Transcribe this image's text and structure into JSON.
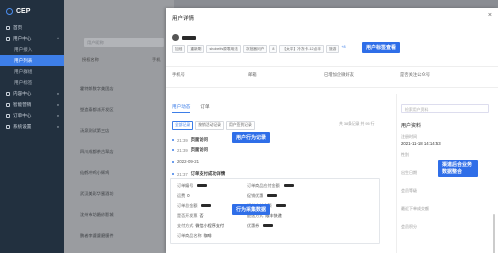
{
  "sidebar": {
    "logo": "CEP",
    "items": [
      {
        "label": "首页",
        "sub": false,
        "active": false
      },
      {
        "label": "用户中心",
        "sub": false,
        "active": false,
        "caret": "^"
      },
      {
        "label": "用户接入",
        "sub": true,
        "active": false
      },
      {
        "label": "用户列表",
        "sub": true,
        "active": true
      },
      {
        "label": "用户群组",
        "sub": true,
        "active": false
      },
      {
        "label": "用户标签",
        "sub": true,
        "active": false
      },
      {
        "label": "内容中心",
        "sub": false,
        "active": false,
        "caret": "v"
      },
      {
        "label": "智能营销",
        "sub": false,
        "active": false,
        "caret": "v"
      },
      {
        "label": "订单中心",
        "sub": false,
        "active": false,
        "caret": "v"
      },
      {
        "label": "系统设置",
        "sub": false,
        "active": false,
        "caret": "v"
      }
    ]
  },
  "main": {
    "search_placeholder": "用户昵称",
    "col_name": "授权名称",
    "col_phone": "手机",
    "rows": [
      "霍特郎数字美团店",
      "塑造泰都派开发区",
      "汤泉测试第三店",
      "四川成都茶古翠店",
      "仙鹤冲鸡小辉鸡",
      "武汉美彩华蜜酒坊",
      "沈州市坊婚纱影城",
      "鹏者李婆婆磨膜件"
    ]
  },
  "panel": {
    "title": "用户详情",
    "close": "×",
    "tags": [
      "加冠",
      "重新刷",
      "shobelfs原零用法",
      "次批器问户",
      "8",
      "【太平】冷冻卡-12点半",
      "旅游"
    ],
    "tags_more": "+8",
    "callout_tags": "用户标签查看",
    "callout_behavior": "用户行为记录",
    "callout_collect": "行为采集数据",
    "callout_merge": "渠道后合业务数据整合",
    "info_labels": [
      "手机号",
      "邮箱",
      "已增加企微好友",
      "是否关注公众号"
    ],
    "tabs": [
      "用户动态",
      "订单"
    ],
    "filters": [
      "全部记录",
      "按销活动记录",
      "用户签到记录"
    ],
    "summary": "共 38条记录  共 95 行"
  },
  "timeline": {
    "items": [
      {
        "time": "21:39",
        "text": "页面访问"
      },
      {
        "time": "21:39",
        "text": "页面访问"
      },
      {
        "time": "",
        "text": "2022-09-21"
      },
      {
        "time": "21:37",
        "text": "订单支付成功详情"
      }
    ],
    "order": [
      {
        "k": "订单编号",
        "v": ""
      },
      {
        "k": "订单商品应付金额",
        "v": ""
      },
      {
        "k": "运费",
        "v": "0"
      },
      {
        "k": "促销优惠",
        "v": ""
      },
      {
        "k": "订单总金额",
        "v": ""
      },
      {
        "k": "订单实付金额",
        "v": ""
      },
      {
        "k": "是否开发票",
        "v": "否"
      },
      {
        "k": "配送方式",
        "v": "顺丰快递"
      },
      {
        "k": "支付方式",
        "v": "微信小程序支付"
      },
      {
        "k": "优惠券",
        "v": ""
      },
      {
        "k": "订单商品名称",
        "v": "咖啡"
      }
    ]
  },
  "side": {
    "search_placeholder": "检索用户资料",
    "title": "用户资料",
    "fields": [
      {
        "k": "注册时间",
        "v": "2021-11-18 14:14:53"
      },
      {
        "k": "性别",
        "v": ""
      },
      {
        "k": "出生日期",
        "v": ""
      },
      {
        "k": "会员等级",
        "v": ""
      },
      {
        "k": "最近下单成交额",
        "v": ""
      },
      {
        "k": "会员积分",
        "v": ""
      }
    ]
  }
}
